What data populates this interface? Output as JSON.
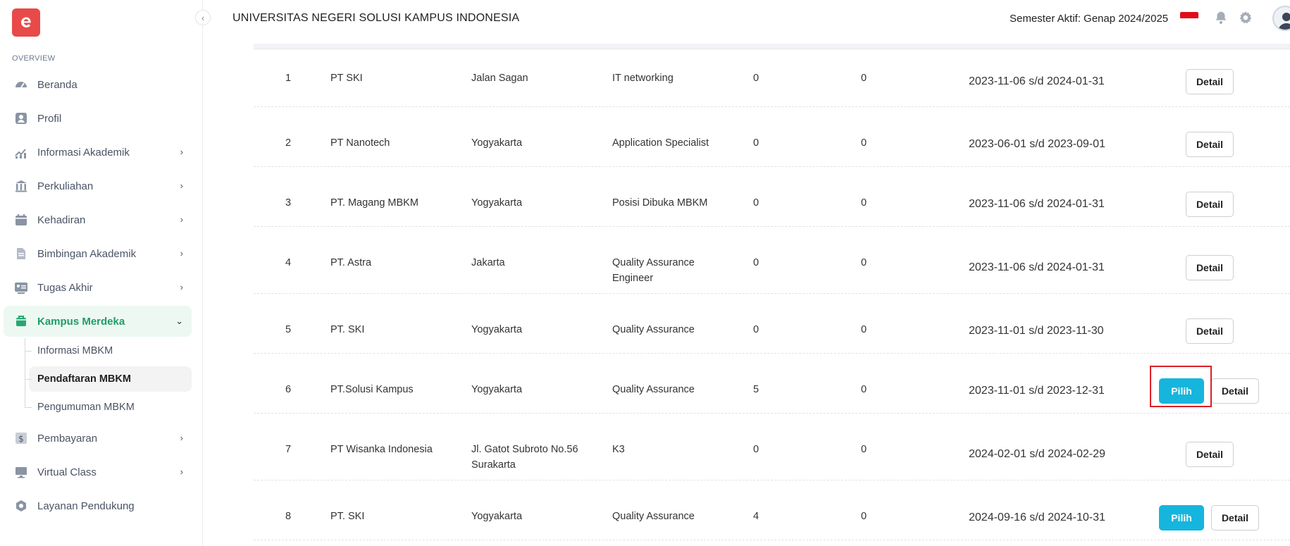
{
  "app": {
    "university": "UNIVERSITAS NEGERI SOLUSI KAMPUS INDONESIA",
    "semester": "Semester Aktif: Genap 2024/2025"
  },
  "sidebar": {
    "section": "OVERVIEW",
    "items": [
      {
        "label": "Beranda",
        "icon": "dashboard-icon",
        "chevron": ""
      },
      {
        "label": "Profil",
        "icon": "user-icon",
        "chevron": ""
      },
      {
        "label": "Informasi Akademik",
        "icon": "chart-icon",
        "chevron": "›"
      },
      {
        "label": "Perkuliahan",
        "icon": "building-icon",
        "chevron": "›"
      },
      {
        "label": "Kehadiran",
        "icon": "calendar-icon",
        "chevron": "›"
      },
      {
        "label": "Bimbingan Akademik",
        "icon": "document-icon",
        "chevron": "›"
      },
      {
        "label": "Tugas Akhir",
        "icon": "id-card-icon",
        "chevron": "›"
      },
      {
        "label": "Kampus Merdeka",
        "icon": "graduation-cap-icon",
        "chevron": "⌄"
      },
      {
        "label": "Pembayaran",
        "icon": "dollar-icon",
        "chevron": "›"
      },
      {
        "label": "Virtual Class",
        "icon": "monitor-icon",
        "chevron": "›"
      },
      {
        "label": "Layanan Pendukung",
        "icon": "support-icon",
        "chevron": ""
      }
    ],
    "submenu": [
      {
        "label": "Informasi MBKM"
      },
      {
        "label": "Pendaftaran MBKM"
      },
      {
        "label": "Pengumuman MBKM"
      }
    ]
  },
  "buttons": {
    "detail": "Detail",
    "pilih": "Pilih"
  },
  "table": {
    "rows": [
      {
        "no": "1",
        "name": "PT SKI",
        "location": "Jalan Sagan",
        "position": "IT networking",
        "q1": "0",
        "q2": "0",
        "period": "2023-11-06 s/d 2024-01-31",
        "pilih": false
      },
      {
        "no": "2",
        "name": "PT Nanotech",
        "location": "Yogyakarta",
        "position": "Application Specialist",
        "q1": "0",
        "q2": "0",
        "period": "2023-06-01 s/d 2023-09-01",
        "pilih": false
      },
      {
        "no": "3",
        "name": "PT. Magang MBKM",
        "location": "Yogyakarta",
        "position": "Posisi Dibuka MBKM",
        "q1": "0",
        "q2": "0",
        "period": "2023-11-06 s/d 2024-01-31",
        "pilih": false
      },
      {
        "no": "4",
        "name": "PT. Astra",
        "location": "Jakarta",
        "position": "Quality Assurance Engineer",
        "q1": "0",
        "q2": "0",
        "period": "2023-11-06 s/d 2024-01-31",
        "pilih": false
      },
      {
        "no": "5",
        "name": "PT. SKI",
        "location": "Yogyakarta",
        "position": "Quality Assurance",
        "q1": "0",
        "q2": "0",
        "period": "2023-11-01 s/d 2023-11-30",
        "pilih": false
      },
      {
        "no": "6",
        "name": "PT.Solusi Kampus",
        "location": "Yogyakarta",
        "position": "Quality Assurance",
        "q1": "5",
        "q2": "0",
        "period": "2023-11-01 s/d 2023-12-31",
        "pilih": true
      },
      {
        "no": "7",
        "name": "PT Wisanka Indonesia",
        "location": "Jl. Gatot Subroto No.56 Surakarta",
        "position": "K3",
        "q1": "0",
        "q2": "0",
        "period": "2024-02-01 s/d 2024-02-29",
        "pilih": false
      },
      {
        "no": "8",
        "name": "PT. SKI",
        "location": "Yogyakarta",
        "position": "Quality Assurance",
        "q1": "4",
        "q2": "0",
        "period": "2024-09-16 s/d 2024-10-31",
        "pilih": true
      }
    ]
  }
}
